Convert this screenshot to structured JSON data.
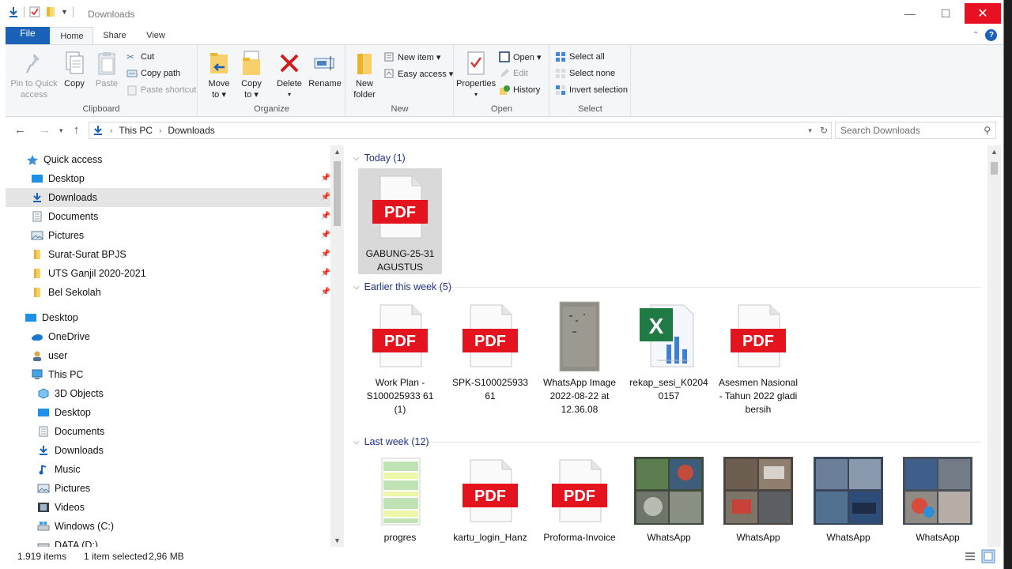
{
  "window": {
    "title": "Downloads",
    "controls": {
      "minimize": "—",
      "maximize": "☐",
      "close": "✕"
    }
  },
  "ribbon_tabs": {
    "file": "File",
    "home": "Home",
    "share": "Share",
    "view": "View"
  },
  "ribbon": {
    "clipboard": {
      "label": "Clipboard",
      "pin_line1": "Pin to Quick",
      "pin_line2": "access",
      "copy": "Copy",
      "paste": "Paste",
      "cut": "Cut",
      "copy_path": "Copy path",
      "paste_shortcut": "Paste shortcut"
    },
    "organize": {
      "label": "Organize",
      "move_to_1": "Move",
      "move_to_2": "to ▾",
      "copy_to_1": "Copy",
      "copy_to_2": "to ▾",
      "delete": "Delete",
      "rename": "Rename"
    },
    "new": {
      "label": "New",
      "new_folder_1": "New",
      "new_folder_2": "folder",
      "new_item": "New item ▾",
      "easy_access": "Easy access ▾"
    },
    "open": {
      "label": "Open",
      "properties": "Properties",
      "open": "Open ▾",
      "edit": "Edit",
      "history": "History"
    },
    "select": {
      "label": "Select",
      "select_all": "Select all",
      "select_none": "Select none",
      "invert": "Invert selection"
    }
  },
  "address": {
    "crumbs": [
      "This PC",
      "Downloads"
    ],
    "search_placeholder": "Search Downloads"
  },
  "nav": {
    "quick_access": "Quick access",
    "quick_items": [
      {
        "label": "Desktop",
        "pinned": true
      },
      {
        "label": "Downloads",
        "pinned": true,
        "selected": true
      },
      {
        "label": "Documents",
        "pinned": true
      },
      {
        "label": "Pictures",
        "pinned": true
      },
      {
        "label": "Surat-Surat BPJS",
        "pinned": true
      },
      {
        "label": "UTS Ganjil 2020-2021",
        "pinned": true
      },
      {
        "label": "Bel Sekolah",
        "pinned": true
      }
    ],
    "desktop": "Desktop",
    "onedrive": "OneDrive",
    "user": "user",
    "this_pc": "This PC",
    "pc_items": [
      "3D Objects",
      "Desktop",
      "Documents",
      "Downloads",
      "Music",
      "Pictures",
      "Videos",
      "Windows (C:)",
      "DATA (D:)"
    ]
  },
  "groups": [
    {
      "title": "Today (1)"
    },
    {
      "title": "Earlier this week (5)"
    },
    {
      "title": "Last week (12)"
    }
  ],
  "files_today": [
    {
      "name": "GABUNG-25-31 AGUSTUS",
      "type": "pdf",
      "selected": true
    }
  ],
  "files_week": [
    {
      "name": "Work Plan - S100025933 61 (1)",
      "type": "pdf"
    },
    {
      "name": "SPK-S100025933 61",
      "type": "pdf"
    },
    {
      "name": "WhatsApp Image 2022-08-22 at 12.36.08",
      "type": "image"
    },
    {
      "name": "rekap_sesi_K0204 0157",
      "type": "excel"
    },
    {
      "name": "Asesmen Nasional - Tahun 2022 gladi bersih",
      "type": "pdf"
    }
  ],
  "files_last": [
    {
      "name": "progres",
      "type": "sheet"
    },
    {
      "name": "kartu_login_Hanz",
      "type": "pdf"
    },
    {
      "name": "Proforma-Invoice",
      "type": "pdf"
    },
    {
      "name": "WhatsApp",
      "type": "photo"
    },
    {
      "name": "WhatsApp",
      "type": "photo"
    },
    {
      "name": "WhatsApp",
      "type": "photo"
    },
    {
      "name": "WhatsApp",
      "type": "photo"
    }
  ],
  "status": {
    "items": "1.919 items",
    "selected": "1 item selected",
    "size": "2,96 MB"
  },
  "colors": {
    "accent": "#1a62b7",
    "close": "#e81123",
    "pdf_red": "#e3141e",
    "selection": "#d9d9d9",
    "group_header": "#1e3287"
  }
}
